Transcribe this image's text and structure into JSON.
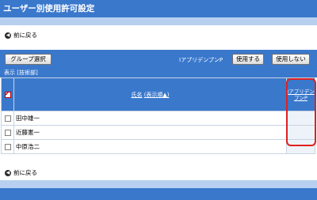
{
  "page": {
    "title": "ユーザー別使用許可設定"
  },
  "nav": {
    "back_label": "前に戻る",
    "back_icon": "back-arrow-icon"
  },
  "toolbar": {
    "group_button": "グループ選択",
    "app_label": "IアプリデンプンP",
    "use_button": "使用する",
    "no_use_button": "使用しない",
    "display_label": "表示 [技術部]"
  },
  "table": {
    "name_header": "氏名",
    "sort_label": "(表示順▲)",
    "app_header": "IアプリデンプンP",
    "rows": [
      {
        "name": "田中雄一"
      },
      {
        "name": "近藤憲一"
      },
      {
        "name": "中原浩二"
      }
    ]
  },
  "colors": {
    "primary": "#3a78cc",
    "stripe": "#b7d0f0",
    "highlight": "#e02020"
  }
}
